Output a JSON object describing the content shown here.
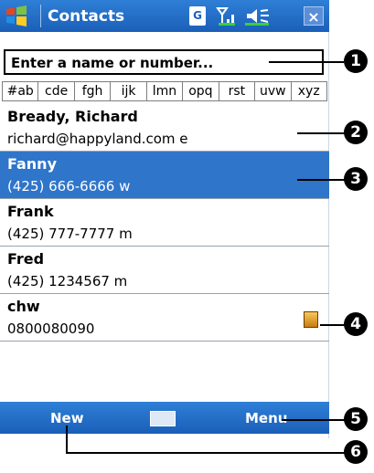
{
  "titlebar": {
    "title": "Contacts",
    "g_label": "G",
    "close_label": "×"
  },
  "search": {
    "placeholder": "Enter a name or number..."
  },
  "tabs": [
    "#ab",
    "cde",
    "fgh",
    "ijk",
    "lmn",
    "opq",
    "rst",
    "uvw",
    "xyz"
  ],
  "contacts": [
    {
      "name": "Bready, Richard",
      "detail": "richard@happyland.com   e",
      "selected": false,
      "card": false
    },
    {
      "name": "Fanny",
      "detail": "(425) 666-6666   w",
      "selected": true,
      "card": false
    },
    {
      "name": "Frank",
      "detail": "(425) 777-7777   m",
      "selected": false,
      "card": false
    },
    {
      "name": "Fred",
      "detail": "(425) 1234567   m",
      "selected": false,
      "card": false
    },
    {
      "name": "chw",
      "detail": "0800080090",
      "selected": false,
      "card": true
    }
  ],
  "bottombar": {
    "new_label": "New",
    "menu_label": "Menu"
  },
  "callouts": [
    "1",
    "2",
    "3",
    "4",
    "5",
    "6"
  ],
  "colors": {
    "accent": "#1a5fb8",
    "selection": "#2f75c9"
  }
}
